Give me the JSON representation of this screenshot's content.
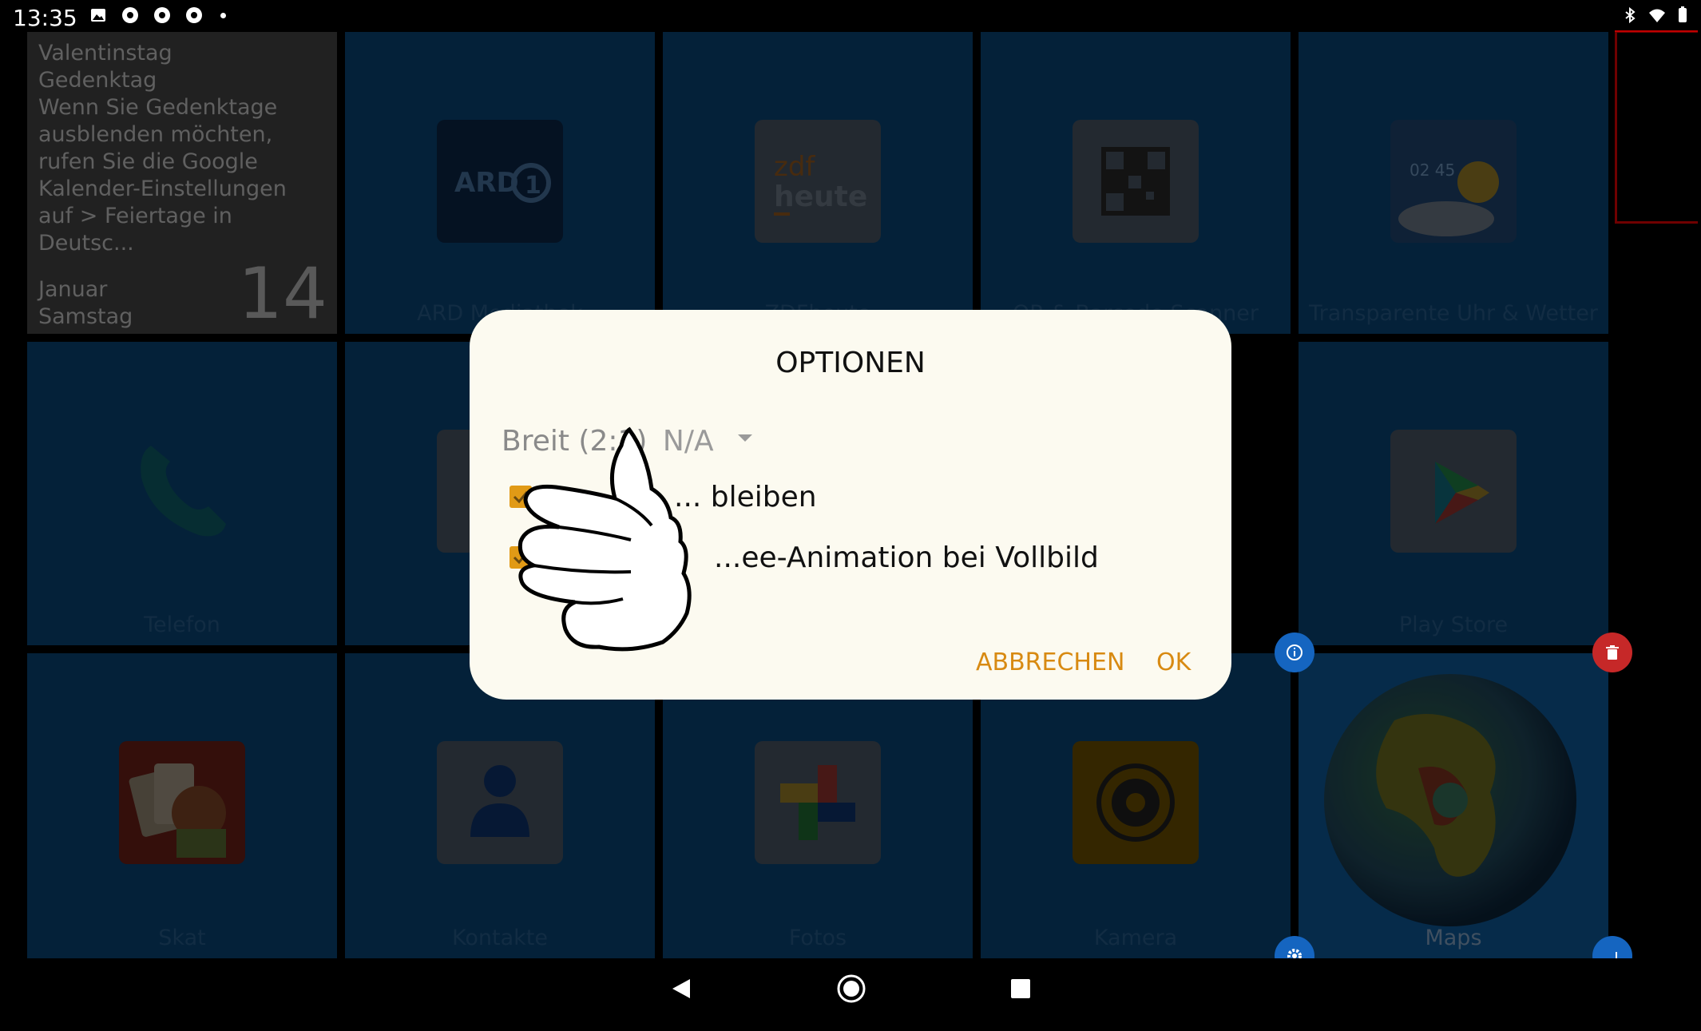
{
  "status_bar": {
    "time": "13:35",
    "left_icons": [
      "image-icon",
      "chrome-icon",
      "chrome-icon",
      "chrome-icon"
    ],
    "right_icons": [
      "bluetooth-icon",
      "wifi-icon",
      "battery-icon"
    ]
  },
  "calendar_widget": {
    "description": "Valentinstag\nGedenktag\nWenn Sie Gedenktage\nausblenden möchten,\nrufen Sie die Google\nKalender-Einstellungen\nauf > Feiertage in Deutsc...",
    "month_weekday": "Januar\nSamstag",
    "day_number": "14"
  },
  "tiles": [
    {
      "label": "ARD Mediathek",
      "icon": "ard-icon"
    },
    {
      "label": "ZDFheute",
      "icon": "zdf-heute-icon"
    },
    {
      "label": "QR & Barcode Scanner",
      "icon": "qr-code-icon"
    },
    {
      "label": "Transparente Uhr & Wetter",
      "icon": "weather-clock-icon"
    },
    {
      "label": "Telefon",
      "icon": "phone-icon"
    },
    {
      "label": "",
      "icon": "app-icon"
    },
    {
      "label": "Play Store",
      "icon": "play-store-icon"
    },
    {
      "label": "Skat",
      "icon": "skat-cards-icon"
    },
    {
      "label": "Kontakte",
      "icon": "contacts-icon"
    },
    {
      "label": "Fotos",
      "icon": "google-photos-icon"
    },
    {
      "label": "Kamera",
      "icon": "camera-icon"
    },
    {
      "label": "Maps",
      "icon": "globe-icon"
    }
  ],
  "dialog": {
    "title": "OPTIONEN",
    "spinner_value": "Breit (2:1)",
    "spinner_secondary": "N/A",
    "checkbox1_label": "... bleiben",
    "checkbox2_label": "...ee-Animation bei Vollbild",
    "cancel_label": "ABBRECHEN",
    "ok_label": "OK"
  },
  "colors": {
    "tile_blue": "#073a63",
    "accent_orange": "#d88a12",
    "dialog_bg": "#fcfaf0"
  }
}
